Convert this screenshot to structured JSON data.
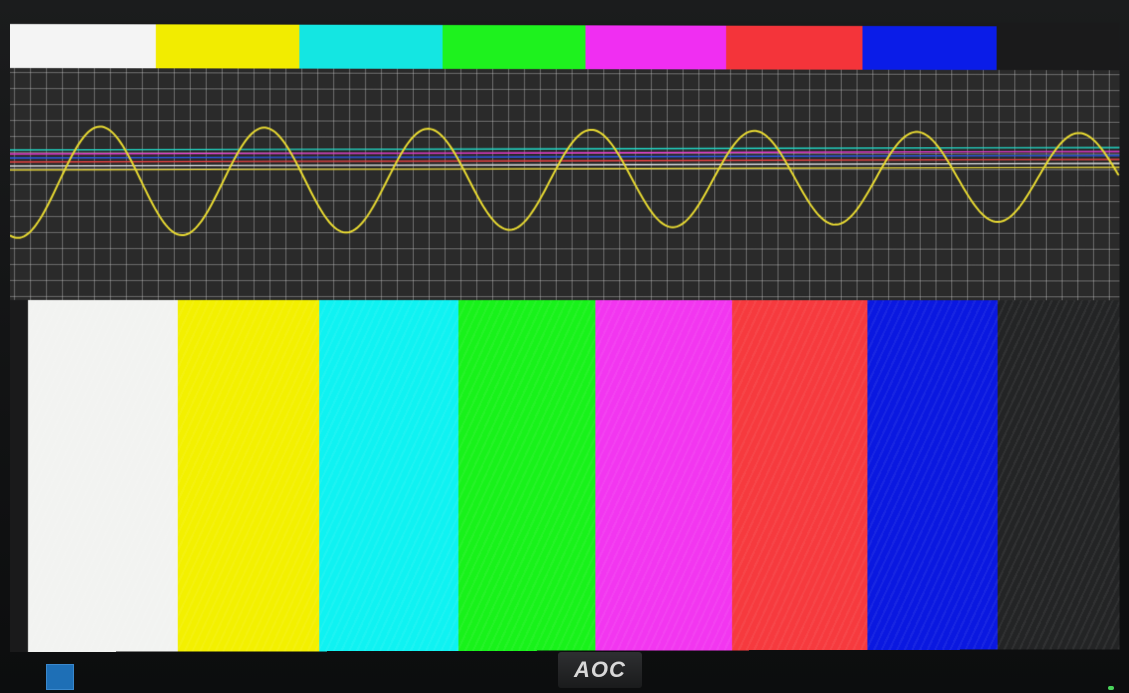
{
  "monitor": {
    "brand_logo": "AOC",
    "sticker_color": "#1e6fb6",
    "power_led_color": "#49d35a"
  },
  "test_pattern": {
    "top_bars": [
      {
        "name": "white",
        "color": "#f4f4f4"
      },
      {
        "name": "yellow",
        "color": "#f2ec00"
      },
      {
        "name": "cyan",
        "color": "#14e6e2"
      },
      {
        "name": "green",
        "color": "#1ef21e"
      },
      {
        "name": "magenta",
        "color": "#f02ef2"
      },
      {
        "name": "red",
        "color": "#f4343a"
      },
      {
        "name": "blue",
        "color": "#0a1ce8"
      }
    ],
    "bottom_bars": [
      {
        "name": "white",
        "color": "#f2f3f1"
      },
      {
        "name": "yellow",
        "color": "#f3f000"
      },
      {
        "name": "cyan",
        "color": "#0ff2f2"
      },
      {
        "name": "green",
        "color": "#18f21a"
      },
      {
        "name": "magenta",
        "color": "#f236f0"
      },
      {
        "name": "red",
        "color": "#f63a3e"
      },
      {
        "name": "blue",
        "color": "#0a18e0"
      },
      {
        "name": "black",
        "color": "#232425"
      }
    ],
    "scope": {
      "background": "#2a2a2a",
      "grid": "dotted",
      "sine_color": "#e6d832",
      "sine_cycles": 6.8,
      "trace_colors": [
        "#21d6c4",
        "#e33ad0",
        "#2e58e8",
        "#e84040",
        "#dcdcdc",
        "#dccc3a"
      ]
    }
  }
}
